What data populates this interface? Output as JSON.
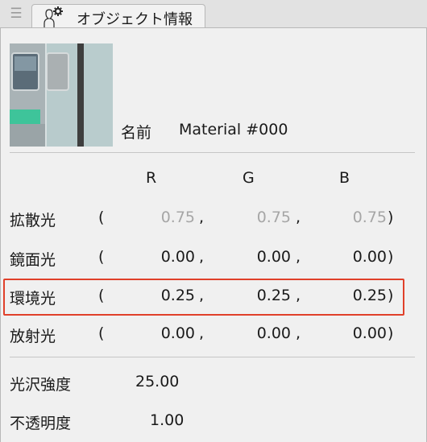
{
  "tab": {
    "menu_icon": "hamburger-icon",
    "icon": "person-gear-icon",
    "title": "オブジェクト情報"
  },
  "material": {
    "name_label": "名前",
    "name_value": "Material #000"
  },
  "columns": {
    "r": "R",
    "g": "G",
    "b": "B"
  },
  "color_rows": [
    {
      "label": "拡散光",
      "open": "(",
      "r": "0.75",
      "g": "0.75",
      "b": "0.75",
      "close": ")",
      "dimmed": true
    },
    {
      "label": "鏡面光",
      "open": "(",
      "r": "0.00",
      "g": "0.00",
      "b": "0.00",
      "close": ")",
      "dimmed": false
    },
    {
      "label": "環境光",
      "open": "(",
      "r": "0.25",
      "g": "0.25",
      "b": "0.25",
      "close": ")",
      "dimmed": false,
      "highlighted": true
    },
    {
      "label": "放射光",
      "open": "(",
      "r": "0.00",
      "g": "0.00",
      "b": "0.00",
      "close": ")",
      "dimmed": false
    }
  ],
  "comma": ",",
  "props": [
    {
      "label": "光沢強度",
      "value": "25.00"
    },
    {
      "label": "不透明度",
      "value": "1.00"
    }
  ],
  "colors": {
    "highlight_border": "#e0402a",
    "dimmed_text": "#a6a6a6",
    "train_stripe": "#3ec49a"
  }
}
